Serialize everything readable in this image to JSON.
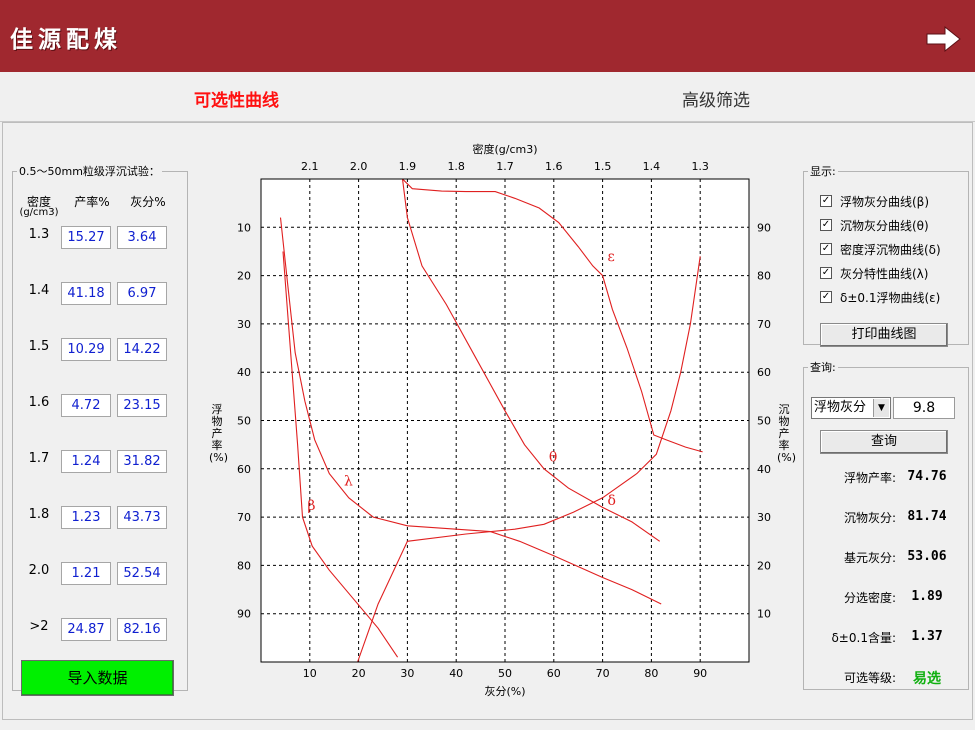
{
  "app": {
    "title": "佳源配煤"
  },
  "tabs": [
    {
      "label": "可选性曲线"
    },
    {
      "label": "高级筛选"
    }
  ],
  "left_panel": {
    "legend": "0.5～50mm粒级浮沉试验：",
    "col_density": "密度",
    "col_density_unit": "(g/cm3)",
    "col_yield": "产率%",
    "col_ash": "灰分%",
    "rows": [
      {
        "density": "1.3",
        "yield": "15.27",
        "ash": "3.64"
      },
      {
        "density": "1.4",
        "yield": "41.18",
        "ash": "6.97"
      },
      {
        "density": "1.5",
        "yield": "10.29",
        "ash": "14.22"
      },
      {
        "density": "1.6",
        "yield": "4.72",
        "ash": "23.15"
      },
      {
        "density": "1.7",
        "yield": "1.24",
        "ash": "31.82"
      },
      {
        "density": "1.8",
        "yield": "1.23",
        "ash": "43.73"
      },
      {
        "density": "2.0",
        "yield": "1.21",
        "ash": "52.54"
      },
      {
        "density": ">2",
        "yield": "24.87",
        "ash": "82.16"
      }
    ],
    "import_button": "导入数据"
  },
  "display_panel": {
    "legend": "显示:",
    "options": [
      {
        "label": "浮物灰分曲线(β)",
        "checked": "✓"
      },
      {
        "label": "沉物灰分曲线(θ)",
        "checked": "✓"
      },
      {
        "label": "密度浮沉物曲线(δ)",
        "checked": "✓"
      },
      {
        "label": "灰分特性曲线(λ)",
        "checked": "✓"
      },
      {
        "label": "δ±0.1浮物曲线(ε)",
        "checked": "✓"
      }
    ],
    "print_button": "打印曲线图"
  },
  "query_panel": {
    "legend": "查询:",
    "select_value": "浮物灰分",
    "input_value": "9.8",
    "query_button": "查询",
    "results": [
      {
        "label": "浮物产率:",
        "value": "74.76"
      },
      {
        "label": "沉物灰分:",
        "value": "81.74"
      },
      {
        "label": "基元灰分:",
        "value": "53.06"
      },
      {
        "label": "分选密度:",
        "value": "1.89"
      },
      {
        "label": "δ±0.1含量:",
        "value": "1.37"
      },
      {
        "label": "可选等级:",
        "value": "易选"
      }
    ]
  },
  "colors": {
    "title_bar": "#a0282f",
    "active_tab": "#ff1010",
    "curve": "#e02020",
    "import_button": "#00f000",
    "grade": "#10b010"
  },
  "chart_data": {
    "type": "line",
    "top_axis_label": "密度(g/cm3)",
    "top_ticks": [
      "2.1",
      "2.0",
      "1.9",
      "1.8",
      "1.7",
      "1.6",
      "1.5",
      "1.4",
      "1.3"
    ],
    "xlabel": "灰分(%)",
    "x_ticks": [
      "10",
      "20",
      "30",
      "40",
      "50",
      "60",
      "70",
      "80",
      "90"
    ],
    "xlim": [
      0,
      100
    ],
    "left_axis_label": "浮物产率(%)",
    "left_ticks": [
      "10",
      "20",
      "30",
      "40",
      "50",
      "60",
      "70",
      "80",
      "90"
    ],
    "left_lim": [
      0,
      100
    ],
    "right_axis_label": "沉物产率(%)",
    "right_ticks": [
      "90",
      "80",
      "70",
      "60",
      "50",
      "40",
      "30",
      "20",
      "10"
    ],
    "grid": true,
    "series": [
      {
        "name": "β",
        "points": [
          [
            4.5,
            15
          ],
          [
            6,
            35
          ],
          [
            7.5,
            55
          ],
          [
            8.5,
            70
          ],
          [
            10.5,
            76
          ],
          [
            14,
            81
          ],
          [
            19,
            87
          ],
          [
            24,
            93
          ],
          [
            28,
            99
          ]
        ]
      },
      {
        "name": "θ",
        "points": [
          [
            29,
            0
          ],
          [
            30,
            8
          ],
          [
            33,
            18
          ],
          [
            38,
            26
          ],
          [
            44,
            37
          ],
          [
            50,
            48
          ],
          [
            54,
            55
          ],
          [
            58,
            60
          ],
          [
            63,
            64
          ],
          [
            70,
            68
          ],
          [
            76,
            71
          ],
          [
            81.7,
            75
          ]
        ]
      },
      {
        "name": "δ",
        "points": [
          [
            19.8,
            100
          ],
          [
            24,
            88
          ],
          [
            30,
            75
          ],
          [
            42,
            73.5
          ],
          [
            52,
            72.5
          ],
          [
            58,
            71.5
          ],
          [
            64,
            69
          ],
          [
            70,
            66
          ],
          [
            77,
            61
          ],
          [
            81,
            57
          ],
          [
            84,
            48
          ],
          [
            86,
            40
          ],
          [
            88,
            30
          ],
          [
            90,
            16
          ]
        ]
      },
      {
        "name": "λ",
        "points": [
          [
            4,
            8
          ],
          [
            5.5,
            22
          ],
          [
            7,
            36
          ],
          [
            9,
            46
          ],
          [
            11,
            54
          ],
          [
            14,
            61
          ],
          [
            18,
            66
          ],
          [
            23,
            70
          ],
          [
            30,
            71.8
          ],
          [
            40,
            72.5
          ],
          [
            47,
            73
          ],
          [
            53,
            75
          ],
          [
            60,
            78
          ],
          [
            70,
            82.5
          ],
          [
            76,
            85
          ],
          [
            82,
            88
          ]
        ]
      },
      {
        "name": "ε",
        "points": [
          [
            29,
            0
          ],
          [
            31,
            2
          ],
          [
            37,
            2.5
          ],
          [
            42,
            2.6
          ],
          [
            48,
            2.6
          ],
          [
            52,
            4
          ],
          [
            57,
            6
          ],
          [
            61,
            9
          ],
          [
            65,
            14
          ],
          [
            68,
            18
          ],
          [
            70,
            20
          ],
          [
            72,
            27
          ],
          [
            75,
            35
          ],
          [
            78,
            44
          ],
          [
            80.5,
            53
          ],
          [
            83,
            54
          ],
          [
            87,
            55.5
          ],
          [
            90.5,
            56.5
          ]
        ]
      }
    ],
    "curve_labels": [
      {
        "text": "β",
        "x": 9.5,
        "y": 68.5
      },
      {
        "text": "θ",
        "x": 59,
        "y": 58.5
      },
      {
        "text": "δ",
        "x": 71,
        "y": 67.5
      },
      {
        "text": "λ",
        "x": 17,
        "y": 63.5
      },
      {
        "text": "ε",
        "x": 71,
        "y": 17
      }
    ]
  }
}
